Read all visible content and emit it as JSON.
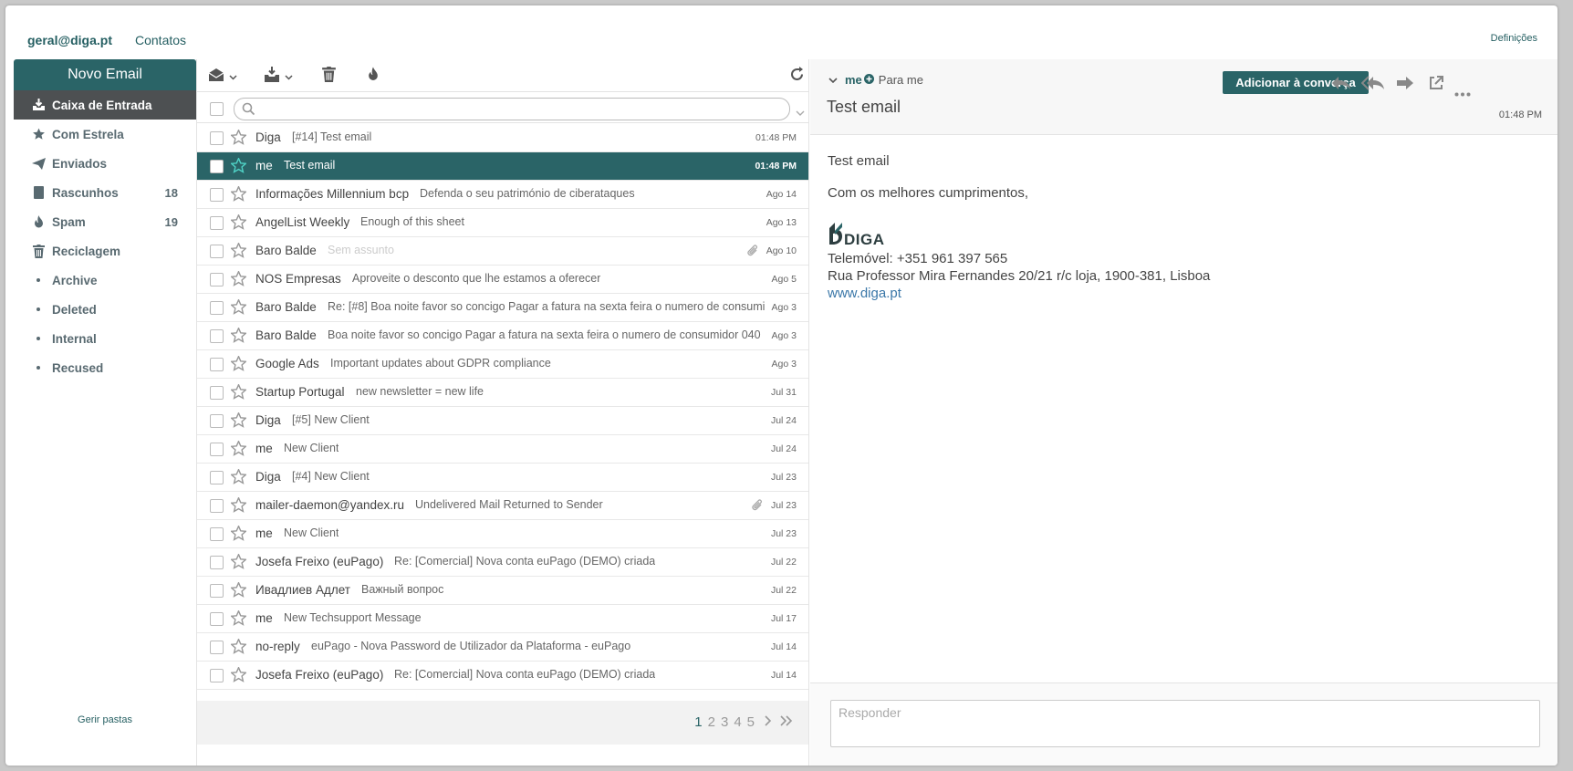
{
  "topbar": {
    "account": "geral@diga.pt",
    "contacts": "Contatos",
    "settings": "Definições"
  },
  "sidebar": {
    "new_email": "Novo Email",
    "folders": [
      {
        "label": "Caixa de Entrada",
        "icon": "inbox-icon",
        "count": ""
      },
      {
        "label": "Com Estrela",
        "icon": "star-icon",
        "count": ""
      },
      {
        "label": "Enviados",
        "icon": "send-icon",
        "count": ""
      },
      {
        "label": "Rascunhos",
        "icon": "draft-icon",
        "count": "18"
      },
      {
        "label": "Spam",
        "icon": "fire-icon",
        "count": "19"
      },
      {
        "label": "Reciclagem",
        "icon": "trash-icon",
        "count": ""
      },
      {
        "label": "Archive",
        "icon": "dot-icon",
        "count": ""
      },
      {
        "label": "Deleted",
        "icon": "dot-icon",
        "count": ""
      },
      {
        "label": "Internal",
        "icon": "dot-icon",
        "count": ""
      },
      {
        "label": "Recused",
        "icon": "dot-icon",
        "count": ""
      }
    ],
    "manage_folders": "Gerir pastas"
  },
  "list": {
    "search_placeholder": "",
    "emails": [
      {
        "from": "Diga",
        "subject": "[#14] Test email",
        "date": "01:48 PM",
        "selected": false,
        "attachment": false
      },
      {
        "from": "me",
        "subject": "Test email",
        "date": "01:48 PM",
        "selected": true,
        "attachment": false
      },
      {
        "from": "Informações Millennium bcp",
        "subject": "Defenda o seu património de ciberataques",
        "date": "Ago 14",
        "selected": false,
        "attachment": false
      },
      {
        "from": "AngelList Weekly",
        "subject": "Enough of this sheet",
        "date": "Ago 13",
        "selected": false,
        "attachment": false
      },
      {
        "from": "Baro Balde",
        "subject": "Sem assunto",
        "date": "Ago 10",
        "selected": false,
        "attachment": true,
        "muted": true
      },
      {
        "from": "NOS Empresas",
        "subject": "Aproveite o desconto que lhe estamos a oferecer",
        "date": "Ago 5",
        "selected": false,
        "attachment": false
      },
      {
        "from": "Baro Balde",
        "subject": "Re: [#8] Boa noite favor so concigo Pagar a fatura na sexta feira o numero de consumi",
        "date": "Ago 3",
        "selected": false,
        "attachment": false
      },
      {
        "from": "Baro Balde",
        "subject": "Boa noite favor so concigo Pagar a fatura na sexta feira o numero de consumidor 040",
        "date": "Ago 3",
        "selected": false,
        "attachment": false
      },
      {
        "from": "Google Ads",
        "subject": "Important updates about GDPR compliance",
        "date": "Ago 3",
        "selected": false,
        "attachment": false
      },
      {
        "from": "Startup Portugal",
        "subject": "new newsletter = new life",
        "date": "Jul 31",
        "selected": false,
        "attachment": false
      },
      {
        "from": "Diga",
        "subject": "[#5] New Client",
        "date": "Jul 24",
        "selected": false,
        "attachment": false
      },
      {
        "from": "me",
        "subject": "New Client",
        "date": "Jul 24",
        "selected": false,
        "attachment": false
      },
      {
        "from": "Diga",
        "subject": "[#4] New Client",
        "date": "Jul 23",
        "selected": false,
        "attachment": false
      },
      {
        "from": "mailer-daemon@yandex.ru",
        "subject": "Undelivered Mail Returned to Sender",
        "date": "Jul 23",
        "selected": false,
        "attachment": true
      },
      {
        "from": "me",
        "subject": "New Client",
        "date": "Jul 23",
        "selected": false,
        "attachment": false
      },
      {
        "from": "Josefa Freixo (euPago)",
        "subject": "Re: [Comercial] Nova conta euPago (DEMO) criada",
        "date": "Jul 22",
        "selected": false,
        "attachment": false
      },
      {
        "from": "Ивадлиев Адлет",
        "subject": "Важный вопрос",
        "date": "Jul 22",
        "selected": false,
        "attachment": false
      },
      {
        "from": "me",
        "subject": "New Techsupport Message",
        "date": "Jul 17",
        "selected": false,
        "attachment": false
      },
      {
        "from": "no-reply",
        "subject": "euPago - Nova Password de Utilizador da Plataforma - euPago",
        "date": "Jul 14",
        "selected": false,
        "attachment": false
      },
      {
        "from": "Josefa Freixo (euPago)",
        "subject": "Re: [Comercial] Nova conta euPago (DEMO) criada",
        "date": "Jul 14",
        "selected": false,
        "attachment": false
      }
    ],
    "pages": [
      "1",
      "2",
      "3",
      "4",
      "5"
    ]
  },
  "reader": {
    "from": "me",
    "to": "Para me",
    "add_to_conversation": "Adicionar à converça",
    "subject": "Test email",
    "date": "01:48 PM",
    "body": "Test email",
    "closing": "Com os melhores cumprimentos,",
    "logo_text": "DIGA",
    "phone": "Telemóvel: +351 961 397 565",
    "address": "Rua Professor Mira Fernandes 20/21 r/c loja, 1900-381, Lisboa",
    "website": "www.diga.pt",
    "reply_placeholder": "Responder"
  },
  "colors": {
    "accent": "#2a6467",
    "sidebar_active": "#4d5052",
    "link": "#3a77a8"
  }
}
